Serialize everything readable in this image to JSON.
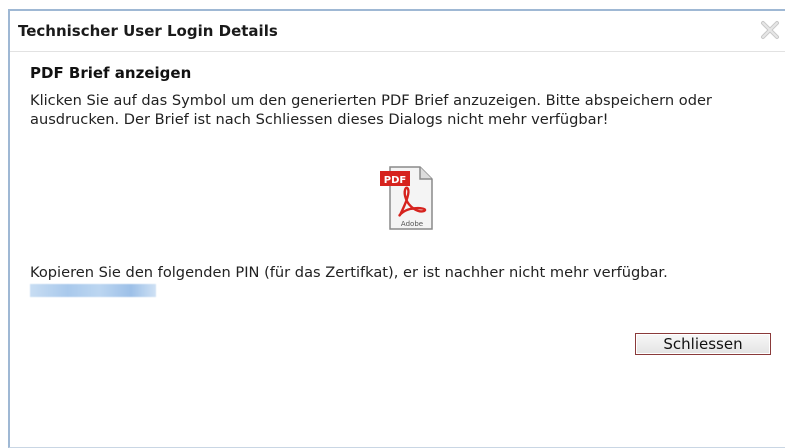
{
  "dialog": {
    "title": "Technischer User Login Details",
    "close_icon": "close-icon"
  },
  "content": {
    "heading": "PDF Brief anzeigen",
    "message": "Klicken Sie auf das Symbol um den generierten PDF Brief anzuzeigen. Bitte abspeichern oder ausdrucken. Der Brief ist nach Schliessen dieses Dialogs nicht mehr verfügbar!",
    "pdf_icon": "pdf-file-icon",
    "pdf_icon_label": "PDF",
    "pdf_icon_brand": "Adobe",
    "pin_label": "Kopieren Sie den folgenden PIN (für das Zertifkat), er ist nachher nicht mehr verfügbar.",
    "pin_value": ""
  },
  "buttons": {
    "close_label": "Schliessen"
  },
  "colors": {
    "border_accent": "#9fb8d4",
    "button_border": "#8a3a3a",
    "pdf_red": "#d6231e"
  }
}
